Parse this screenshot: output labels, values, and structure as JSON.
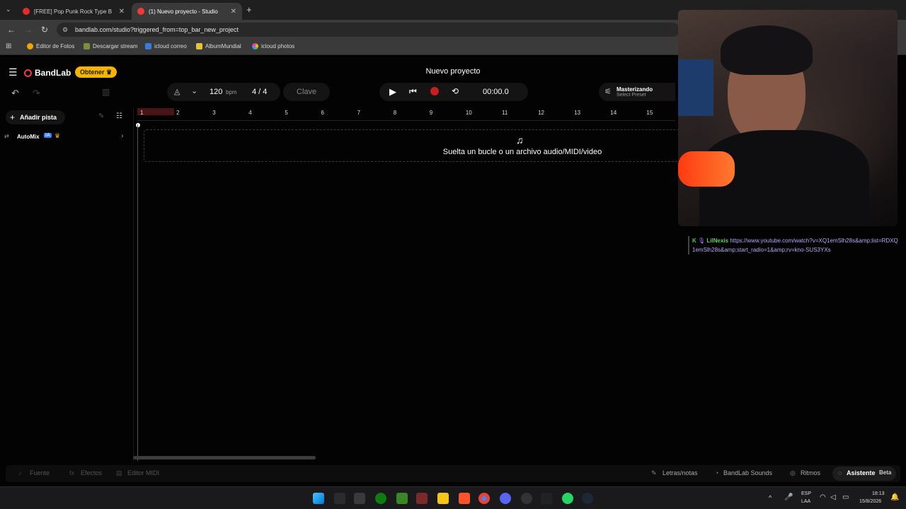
{
  "browser": {
    "tabs": [
      {
        "title": "[FREE] Pop Punk Rock Type Bea",
        "active": false
      },
      {
        "title": "(1) Nuevo proyecto - Studio",
        "active": true
      }
    ],
    "new_tab": "+",
    "url": "bandlab.com/studio?triggered_from=top_bar_new_project",
    "bookmarks": [
      "Editor de Fotos",
      "Descargar stream",
      "icloud correo",
      "AlbumMundial",
      "icloud photos"
    ]
  },
  "app": {
    "logo": "BandLab",
    "get_button": "Obtener",
    "project_title": "Nuevo proyecto",
    "tempo": "120",
    "tempo_unit": "bpm",
    "time_signature": "4 / 4",
    "key_button": "Clave",
    "time_display": "00:00.0",
    "mastering": {
      "title": "Masterizando",
      "subtitle": "Select Preset"
    },
    "add_track": "Añadir pista",
    "automix": "AutoMix",
    "automix_badge": "IA",
    "ruler": [
      "1",
      "2",
      "3",
      "4",
      "5",
      "6",
      "7",
      "8",
      "9",
      "10",
      "11",
      "12",
      "13",
      "14",
      "15"
    ],
    "drop_text": "Suelta un bucle o un archivo audio/MIDI/video",
    "bottom": {
      "fuente": "Fuente",
      "efectos": "Efectos",
      "editor_midi": "Editor MIDI",
      "letras": "Letras/notas",
      "sounds": "BandLab Sounds",
      "ritmos": "Ritmos",
      "asistente": "Asistente",
      "beta": "Beta"
    },
    "colors": {
      "accent_red": "#f23a3a",
      "gold": "#f5b400"
    }
  },
  "chat": {
    "user": "LilNexis",
    "message": "https://www.youtube.com/watch?v=XQ1emSlh28s&amp;list=RDXQ1emSlh28s&amp;start_radio=1&amp;rv=kno-SUS3YXs"
  },
  "taskbar": {
    "lang_top": "ESP",
    "lang_bottom": "LAA",
    "time": "18:13",
    "date": "15/8/2026"
  }
}
